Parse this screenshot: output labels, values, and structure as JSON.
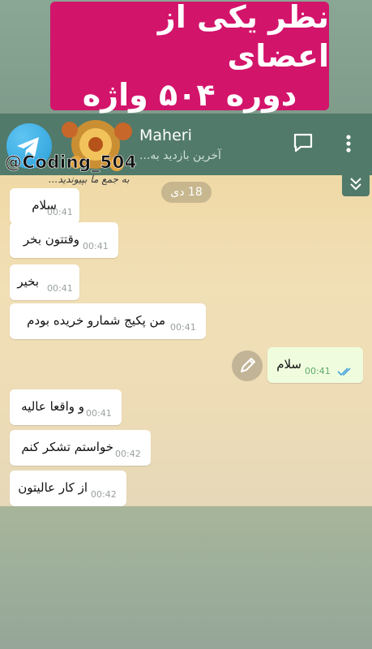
{
  "banner": {
    "line1": "نظر یکی از اعضای",
    "line2": "دوره ۵۰۴ واژه"
  },
  "header": {
    "name": "Maheri",
    "status": "آخرین بازدید به..."
  },
  "watermark": {
    "handle": "@Coding_504",
    "tagline": "به جمع ما بپیوندید..."
  },
  "chat": {
    "date": "18 دی",
    "messages": [
      {
        "text": "سلام",
        "time": "00:41",
        "dir": "in"
      },
      {
        "text": "وقتتون بخر",
        "time": "00:41",
        "dir": "in"
      },
      {
        "text": "بخیر",
        "time": "00:41",
        "dir": "in"
      },
      {
        "text": "من پکیج شمارو خریده بودم",
        "time": "00:41",
        "dir": "in"
      },
      {
        "text": "سلام",
        "time": "00:41",
        "dir": "out"
      },
      {
        "text": "و واقعا عالیه",
        "time": "00:41",
        "dir": "in"
      },
      {
        "text": "خواستم تشکر کنم",
        "time": "00:42",
        "dir": "in"
      },
      {
        "text": "از کار عالیتون",
        "time": "00:42",
        "dir": "in"
      }
    ]
  },
  "icons": {
    "telegram": "telegram-logo-icon",
    "chat": "chat-bubble-icon",
    "more": "more-vertical-icon",
    "expand": "chevron-double-down-icon",
    "edit": "pencil-icon",
    "read": "double-check-icon"
  },
  "colors": {
    "banner": "#d3146b",
    "header": "#517a6a",
    "outgoing_bubble": "#effdde",
    "check": "#4aa3df"
  }
}
